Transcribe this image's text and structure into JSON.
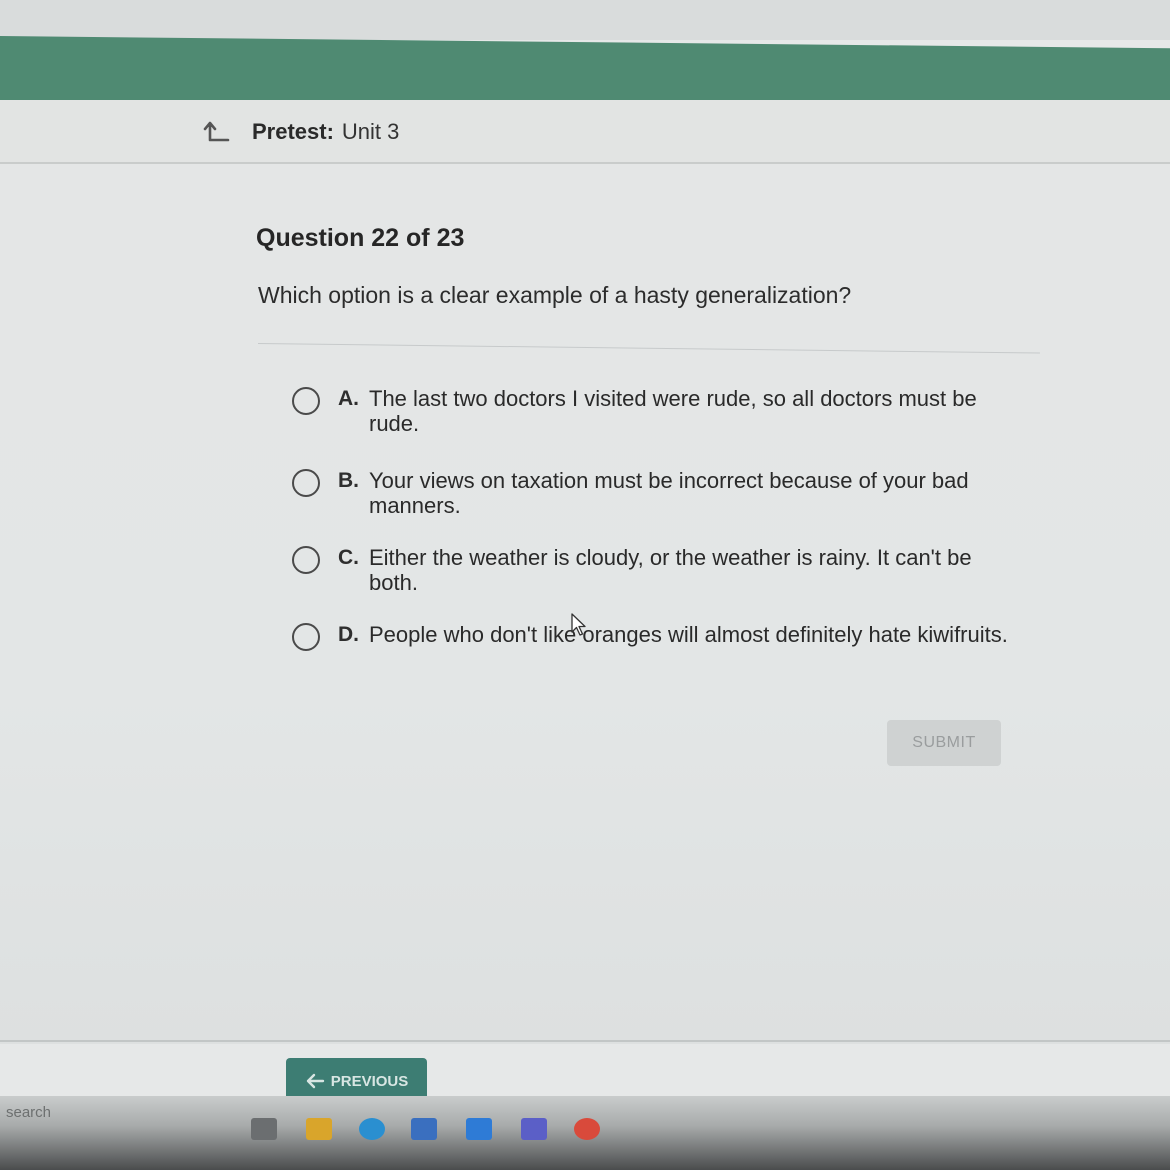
{
  "header": {
    "title_bold": "Pretest:",
    "title_rest": "Unit 3"
  },
  "question": {
    "number_label": "Question 22 of 23",
    "prompt": "Which option is a clear example of a hasty generalization?"
  },
  "options": [
    {
      "letter": "A.",
      "text": "The last two doctors I visited were rude, so all doctors must be rude."
    },
    {
      "letter": "B.",
      "text": "Your views on taxation must be incorrect because of your bad manners."
    },
    {
      "letter": "C.",
      "text": "Either the weather is cloudy, or the weather is rainy. It can't be both."
    },
    {
      "letter": "D.",
      "text": "People who don't like oranges will almost definitely hate kiwifruits."
    }
  ],
  "buttons": {
    "submit": "SUBMIT",
    "previous": "PREVIOUS"
  },
  "taskbar": {
    "search_label": "search"
  },
  "colors": {
    "brand_green": "#4f8a72",
    "previous_button": "#3d7d73"
  }
}
